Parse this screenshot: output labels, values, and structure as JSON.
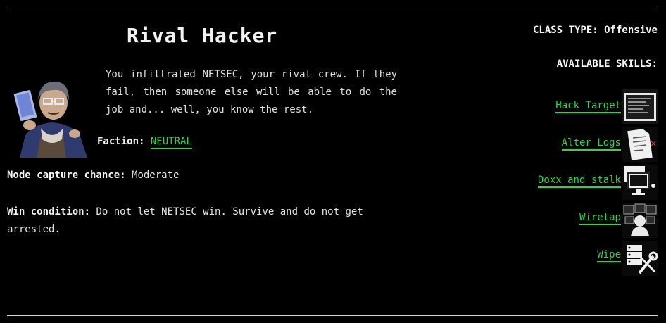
{
  "card": {
    "title": "Rival Hacker",
    "description": "You infiltrated NETSEC, your rival crew. If they fail, then someone else will be able to do the job and... well, you know the rest.",
    "faction_label": "Faction:",
    "faction_value": "NEUTRAL",
    "node_label": "Node capture chance:",
    "node_value": "Moderate",
    "win_label": "Win condition:",
    "win_value": "Do not let NETSEC win. Survive and do not get arrested."
  },
  "sidebar": {
    "class_type": "CLASS TYPE: Offensive",
    "skills_header": "AVAILABLE SKILLS:",
    "skills": [
      {
        "label": "Hack Target",
        "icon": "terminal-screen-icon"
      },
      {
        "label": "Alter Logs",
        "icon": "document-icon"
      },
      {
        "label": "Doxx and stalk",
        "icon": "monitor-icon"
      },
      {
        "label": "Wiretap",
        "icon": "wiretap-icon"
      },
      {
        "label": "Wipe",
        "icon": "server-wrench-icon"
      }
    ]
  },
  "colors": {
    "accent": "#27d84a",
    "background": "#000000",
    "text": "#e6e6e6",
    "alert": "#e53935"
  }
}
